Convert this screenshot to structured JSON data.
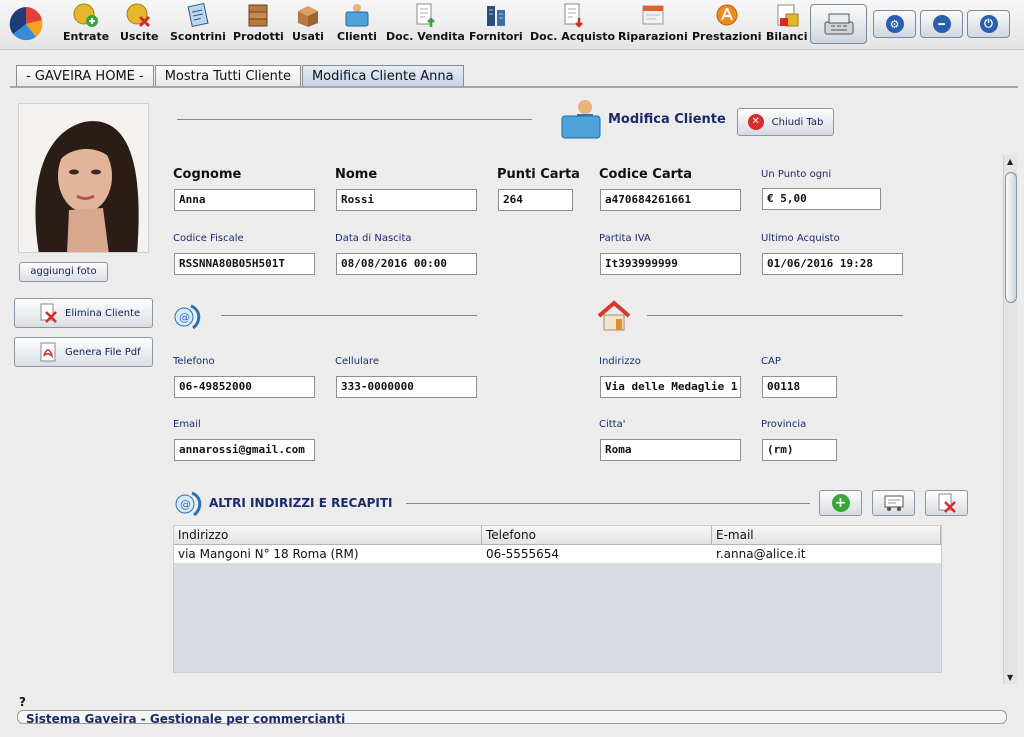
{
  "toolbar": {
    "items": [
      {
        "label": "Entrate",
        "icon": "coin-plus-icon"
      },
      {
        "label": "Uscite",
        "icon": "coin-minus-icon"
      },
      {
        "label": "Scontrini",
        "icon": "receipt-icon"
      },
      {
        "label": "Prodotti",
        "icon": "boxes-icon"
      },
      {
        "label": "Usati",
        "icon": "open-box-icon"
      },
      {
        "label": "Clienti",
        "icon": "client-folder-icon"
      },
      {
        "label": "Doc. Vendita",
        "icon": "sale-document-icon"
      },
      {
        "label": "Fornitori",
        "icon": "supplier-icon"
      },
      {
        "label": "Doc. Acquisto",
        "icon": "purchase-document-icon"
      },
      {
        "label": "Riparazioni",
        "icon": "repair-icon"
      },
      {
        "label": "Prestazioni",
        "icon": "services-icon"
      },
      {
        "label": "Bilanci",
        "icon": "balance-icon"
      }
    ]
  },
  "tabs": [
    {
      "label": "- GAVEIRA HOME -"
    },
    {
      "label": "Mostra Tutti Cliente"
    },
    {
      "label": "Modifica Cliente Anna"
    }
  ],
  "sidebar": {
    "add_photo_label": "aggiungi foto",
    "delete_label": "Elimina Cliente",
    "pdf_label": "Genera File Pdf"
  },
  "header": {
    "title": "Modifica Cliente",
    "close_tab_label": "Chiudi Tab"
  },
  "form": {
    "cognome": {
      "label": "Cognome",
      "value": "Anna"
    },
    "nome": {
      "label": "Nome",
      "value": "Rossi"
    },
    "punti_carta": {
      "label": "Punti Carta",
      "value": "264"
    },
    "codice_carta": {
      "label": "Codice Carta",
      "value": "a470684261661"
    },
    "un_punto_ogni": {
      "label": "Un Punto ogni",
      "value": "€ 5,00"
    },
    "codice_fiscale": {
      "label": "Codice Fiscale",
      "value": "RSSNNA80B05H501T"
    },
    "data_nascita": {
      "label": "Data di Nascita",
      "value": "08/08/2016 00:00"
    },
    "partita_iva": {
      "label": "Partita IVA",
      "value": "It393999999"
    },
    "ultimo_acquisto": {
      "label": "Ultimo Acquisto",
      "value": "01/06/2016 19:28"
    },
    "telefono": {
      "label": "Telefono",
      "value": "06-49852000"
    },
    "cellulare": {
      "label": "Cellulare",
      "value": "333-0000000"
    },
    "email": {
      "label": "Email",
      "value": "annarossi@gmail.com"
    },
    "indirizzo": {
      "label": "Indirizzo",
      "value": "Via delle Medaglie 1"
    },
    "cap": {
      "label": "CAP",
      "value": "00118"
    },
    "citta": {
      "label": "Citta'",
      "value": "Roma"
    },
    "provincia": {
      "label": "Provincia",
      "value": "(rm)"
    }
  },
  "other_addresses": {
    "title": "ALTRI INDIRIZZI E RECAPITI",
    "columns": [
      "Indirizzo",
      "Telefono",
      "E-mail"
    ],
    "rows": [
      {
        "indirizzo": "via Mangoni N° 18 Roma (RM)",
        "telefono": "06-5555654",
        "email": "r.anna@alice.it"
      }
    ]
  },
  "status": {
    "help": "?",
    "text": "Sistema Gaveira - Gestionale per commercianti"
  },
  "colors": {
    "accent_text": "#1b2a6b",
    "danger": "#d62b2b",
    "success": "#3aa53a"
  }
}
